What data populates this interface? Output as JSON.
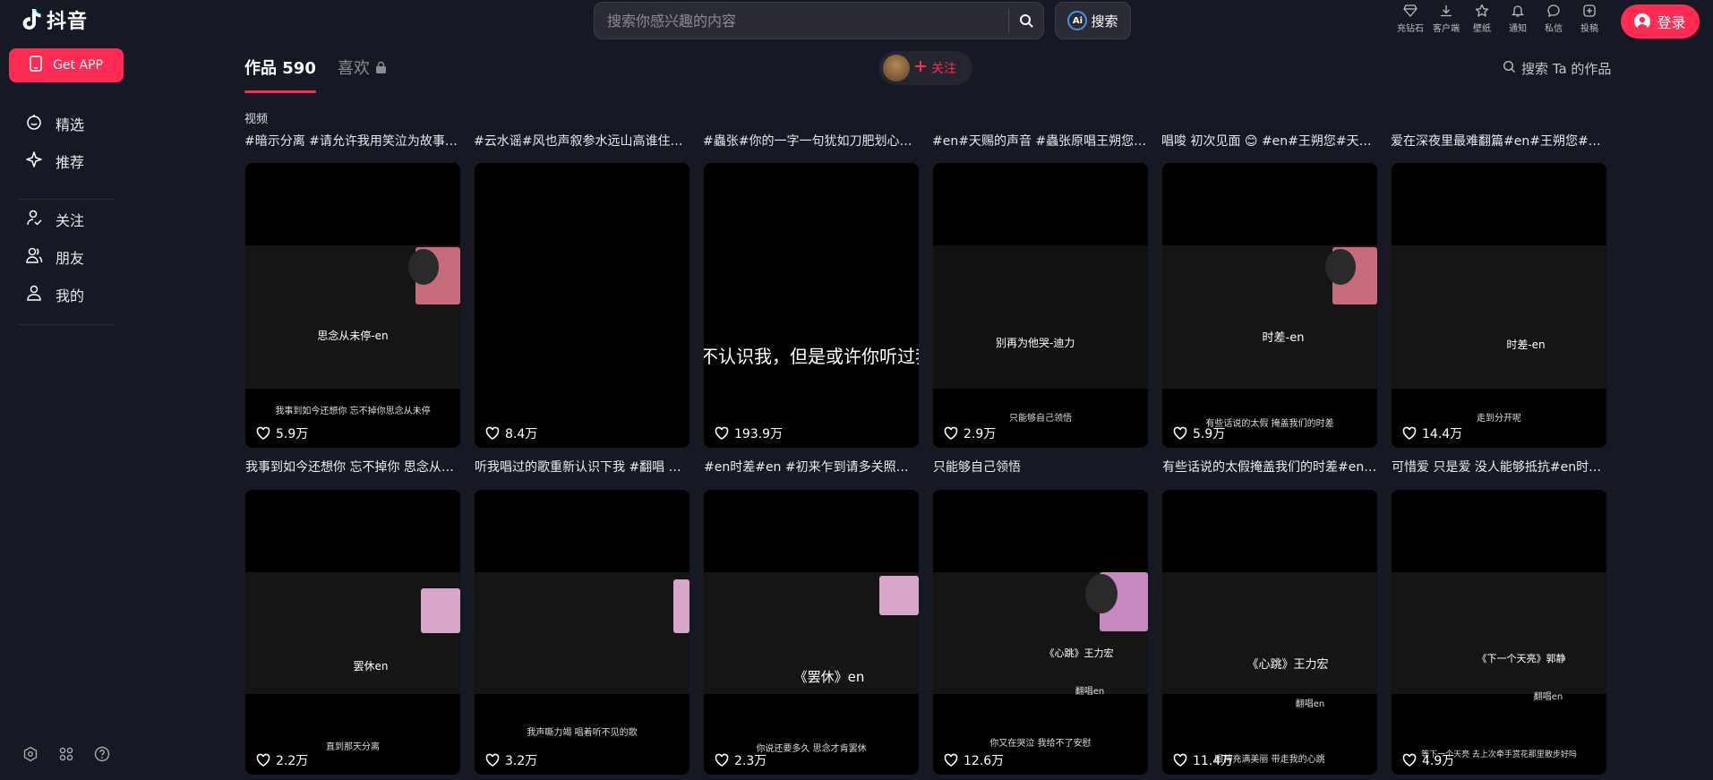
{
  "brand": {
    "name": "抖音"
  },
  "sidebar": {
    "get_app": "Get APP",
    "items": [
      {
        "label": "精选",
        "icon": "featured-icon"
      },
      {
        "label": "推荐",
        "icon": "recommend-icon"
      },
      {
        "label": "关注",
        "icon": "follow-icon"
      },
      {
        "label": "朋友",
        "icon": "friends-icon"
      },
      {
        "label": "我的",
        "icon": "me-icon"
      }
    ]
  },
  "header": {
    "search_placeholder": "搜索你感兴趣的内容",
    "ai_search_label": "搜索",
    "ai_badge": "Ai",
    "actions": [
      {
        "label": "充钻石",
        "icon": "diamond-icon"
      },
      {
        "label": "客户端",
        "icon": "download-icon"
      },
      {
        "label": "壁纸",
        "icon": "wallpaper-icon"
      },
      {
        "label": "通知",
        "icon": "bell-icon"
      },
      {
        "label": "私信",
        "icon": "message-icon"
      },
      {
        "label": "投稿",
        "icon": "upload-icon"
      }
    ],
    "login_label": "登录"
  },
  "profile": {
    "tab_works_label": "作品",
    "tab_works_count": "590",
    "tab_likes_label": "喜欢",
    "follow_label": "关注",
    "search_works_label": "搜索 Ta 的作品",
    "section_label": "视频"
  },
  "top_titles": [
    "#暗示分离 #请允许我用笑泣为故事…",
    "#云水谣#风也声叙参水远山高谁住…",
    "#蟲张#你的一字一句犹如刀肥划心…",
    "#en#天赐的声音 #蟲张原唱王朔您…",
    "唱唆 初次见面 😊 #en#王朔您#天赐…",
    "爱在深夜里最难翻篇#en#王朔您#…"
  ],
  "videos": [
    {
      "caption": "思念从未停-en",
      "subcaption": "我事到如今还想你 忘不掉你思念从未停",
      "likes": "5.9万",
      "title": "我事到如今还想你 忘不掉你 思念从…"
    },
    {
      "caption": "",
      "subcaption": "",
      "likes": "8.4万",
      "title": "听我唱过的歌重新认识下我 #翻唱 #…"
    },
    {
      "caption": "不认识我，但是或许你听过我",
      "subcaption": "",
      "likes": "193.9万",
      "title": "#en时差#en #初来乍到请多关照#你…"
    },
    {
      "caption": "别再为他哭-迪力",
      "subcaption": "只能够自己领悟",
      "likes": "2.9万",
      "title": "只能够自己领悟"
    },
    {
      "caption": "时差-en",
      "subcaption": "有些话说的太假 掩盖我们的时差",
      "likes": "5.9万",
      "title": "有些话说的太假掩盖我们的时差#en…"
    },
    {
      "caption": "时差-en",
      "subcaption": "走到分开呢",
      "likes": "14.4万",
      "title": "可惜爱 只是爱 没人能够抵抗#en时…"
    },
    {
      "caption": "罢休en",
      "subcaption": "直到那天分离",
      "likes": "2.2万",
      "title": ""
    },
    {
      "caption": "",
      "subcaption": "我声嘶力竭 唱着听不见的歌",
      "likes": "3.2万",
      "title": ""
    },
    {
      "caption": "《罢休》en",
      "subcaption": "你说还要多久 思念才肯罢休",
      "likes": "2.3万",
      "title": ""
    },
    {
      "caption": "《心跳》王力宏",
      "subcaption": "你又在哭泣 我给不了安慰",
      "likes": "12.6万",
      "title": "",
      "caption2": "翻唱en"
    },
    {
      "caption": "《心跳》王力宏",
      "subcaption": "眼神充满美丽 带走我的心跳",
      "likes": "11.4万",
      "title": "",
      "caption2": "翻唱en"
    },
    {
      "caption": "《下一个天亮》郭静",
      "subcaption": "等下一个天亮 去上次牵手赏花那里散步好吗",
      "likes": "4.9万",
      "title": "",
      "caption2": "翻唱en"
    }
  ],
  "colors": {
    "accent": "#fe2c55",
    "background": "#161823"
  }
}
